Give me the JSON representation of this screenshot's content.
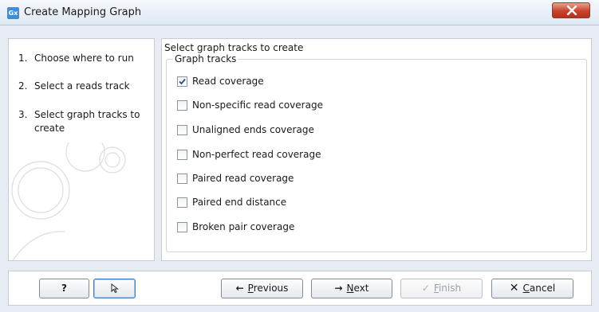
{
  "window": {
    "title": "Create Mapping Graph",
    "app_icon": "Gx"
  },
  "steps": [
    {
      "num": "1.",
      "label": "Choose where to run"
    },
    {
      "num": "2.",
      "label": "Select a reads track"
    },
    {
      "num": "3.",
      "label": "Select graph tracks to create"
    }
  ],
  "content": {
    "instruction": "Select graph tracks to create",
    "group_title": "Graph tracks",
    "options": [
      {
        "label": "Read coverage",
        "checked": true
      },
      {
        "label": "Non-specific read coverage",
        "checked": false
      },
      {
        "label": "Unaligned ends coverage",
        "checked": false
      },
      {
        "label": "Non-perfect read coverage",
        "checked": false
      },
      {
        "label": "Paired read coverage",
        "checked": false
      },
      {
        "label": "Paired end distance",
        "checked": false
      },
      {
        "label": "Broken pair coverage",
        "checked": false
      }
    ]
  },
  "buttons": {
    "help": "?",
    "previous_prefix": "",
    "previous_mnemonic": "P",
    "previous_rest": "revious",
    "next_mnemonic": "N",
    "next_rest": "ext",
    "finish_mnemonic": "F",
    "finish_rest": "inish",
    "cancel_mnemonic": "C",
    "cancel_rest": "ancel"
  },
  "icons": {
    "title_close": "close-icon",
    "previous": "arrow-left-icon",
    "next": "arrow-right-icon",
    "finish": "checkmark-icon",
    "cancel": "x-icon",
    "reset": "reset-cursor-icon"
  }
}
